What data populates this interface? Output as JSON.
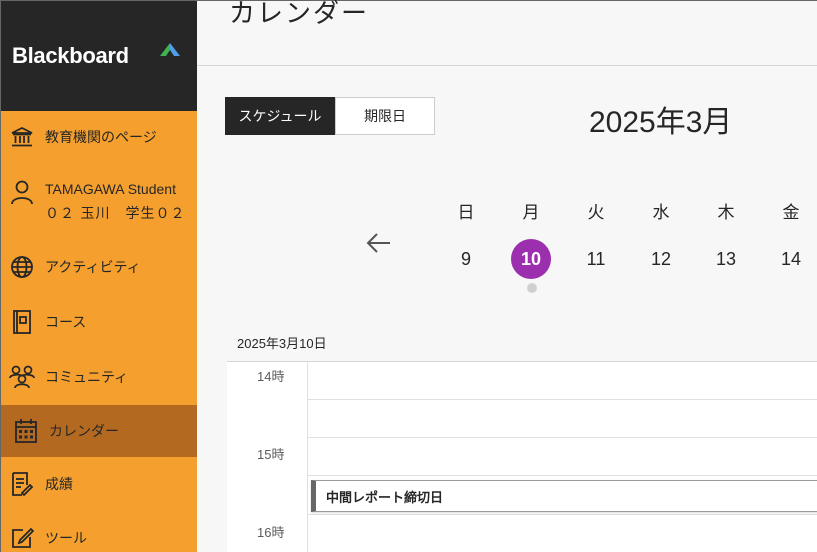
{
  "brand": {
    "name": "Blackboard"
  },
  "sidebar": {
    "items": [
      {
        "label": "教育機関のページ",
        "icon": "institution-icon"
      },
      {
        "name": "TAMAGAWA Student",
        "sub": "０２ 玉川　学生０２",
        "icon": "user-icon"
      },
      {
        "label": "アクティビティ",
        "icon": "globe-icon"
      },
      {
        "label": "コース",
        "icon": "course-icon"
      },
      {
        "label": "コミュニティ",
        "icon": "community-icon"
      },
      {
        "label": "カレンダー",
        "icon": "calendar-icon",
        "active": true
      },
      {
        "label": "成績",
        "icon": "grades-icon"
      },
      {
        "label": "ツール",
        "icon": "tools-icon"
      }
    ]
  },
  "main": {
    "title": "カレンダー",
    "view_tabs": {
      "schedule": "スケジュール",
      "due_dates": "期限日",
      "selected": "スケジュール"
    },
    "month_title": "2025年3月",
    "week": {
      "days": [
        {
          "name": "日",
          "num": "9"
        },
        {
          "name": "月",
          "num": "10",
          "selected": true
        },
        {
          "name": "火",
          "num": "11"
        },
        {
          "name": "水",
          "num": "12"
        },
        {
          "name": "木",
          "num": "13"
        },
        {
          "name": "金",
          "num": "14"
        }
      ]
    },
    "date_label": "2025年3月10日",
    "hours": [
      "14時",
      "15時",
      "16時"
    ],
    "events": [
      {
        "title": "中間レポート締切日"
      }
    ]
  },
  "colors": {
    "sidebar_bg": "#f5a02e",
    "sidebar_active": "#b36a20",
    "logo_bg": "#262626",
    "selected_day": "#9b2fae"
  }
}
